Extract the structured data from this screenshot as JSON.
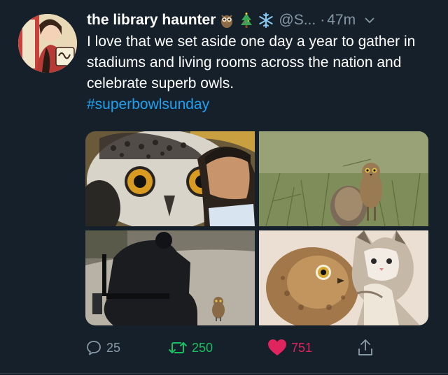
{
  "tweet": {
    "display_name": "the library haunter",
    "name_emojis": [
      "owl-emoji",
      "christmas-tree-emoji",
      "snowflake-emoji"
    ],
    "handle": "@S...",
    "separator": "·",
    "time": "47m",
    "text": "I love that we set aside one day a year to gather in stadiums and living rooms across the nation and celebrate superb owls.",
    "hashtag": "#superbowlsunday",
    "media": [
      {
        "name": "snowy-owl-photo",
        "icon": "owl-photo"
      },
      {
        "name": "burrowing-owls-photo",
        "icon": "owl-photo"
      },
      {
        "name": "police-officer-owl-photo",
        "icon": "owl-photo"
      },
      {
        "name": "owl-kitten-photo",
        "icon": "owl-photo"
      }
    ]
  },
  "actions": {
    "reply_count": "25",
    "retweet_count": "250",
    "like_count": "751"
  },
  "colors": {
    "background": "#15202b",
    "secondary_text": "#8899a6",
    "link": "#1da1f2",
    "retweet": "#17bf63",
    "like": "#e0245e"
  }
}
